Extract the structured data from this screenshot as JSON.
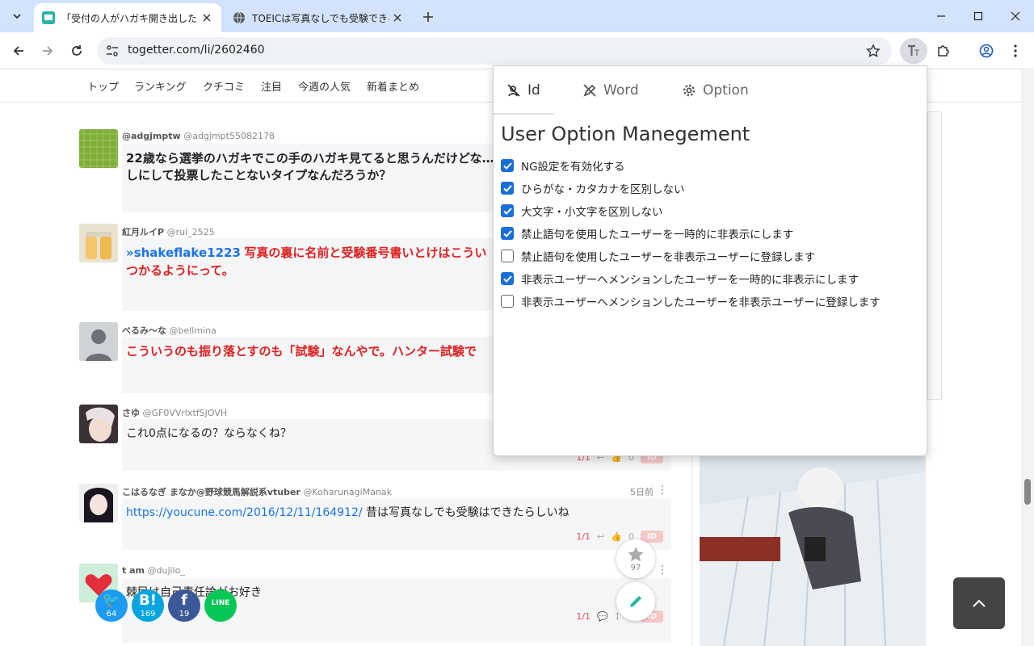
{
  "browser": {
    "tabs": [
      {
        "title": "「受付の人がハガキ開き出したとき？",
        "active": true
      },
      {
        "title": "TOEICは写真なしでも受験できる",
        "active": false
      }
    ],
    "url": "togetter.com/li/2602460"
  },
  "site_nav": [
    "トップ",
    "ランキング",
    "クチコミ",
    "注目",
    "今週の人気",
    "新着まとめ"
  ],
  "posts": [
    {
      "name": "@adgjmptw",
      "handle": "@adgjmpt55082178",
      "line1": "22歳なら選挙のハガキでこの手のハガキ見てると思うんだけどな… もし",
      "line2": "しにして投票したことないタイプなんだろうか？"
    },
    {
      "name": "紅月ルイP",
      "handle": "@rui_2525",
      "mention": "»shakeflake1223",
      "line1": "写真の裏に名前と受験番号書いとけはこうい",
      "line2": "つかるようにって。"
    },
    {
      "name": "べるみ～な",
      "handle": "@bellmina",
      "line1": "こういうのも振り落とすのも「試験」なんやで。ハンター試験で"
    },
    {
      "name": "さゆ",
      "handle": "@GF0VVrlxtfSJOVH",
      "line1": "これ0点になるの？ならなくね？",
      "page": "1/1",
      "likes": "0",
      "id": "ID"
    },
    {
      "name": "こはるなぎ まなか@野球競馬解説系vtuber",
      "handle": "@KoharunagiManak",
      "time": "5日前",
      "link": "https://youcune.com/2016/12/11/164912/",
      "line1": " 昔は写真なしでも受験はできたらしいね",
      "page": "1/1",
      "likes": "0",
      "id": "ID"
    },
    {
      "name": "t am",
      "handle": "@dujilo_",
      "line1": "棘民は自己責任論がお好き",
      "page": "1/1",
      "replies": "1",
      "id": "ID"
    }
  ],
  "share": [
    {
      "label": "twitter-share",
      "glyph": "🐦",
      "count": "64",
      "color": "#1d9bf0"
    },
    {
      "label": "hatena-share",
      "glyph": "B!",
      "count": "169",
      "color": "#00a4de"
    },
    {
      "label": "facebook-share",
      "glyph": "f",
      "count": "19",
      "color": "#3b5998"
    },
    {
      "label": "line-share",
      "glyph": "LINE",
      "count": "",
      "color": "#06c755"
    }
  ],
  "favorite_count": "97",
  "popup": {
    "tabs": [
      "Id",
      "Word",
      "Option"
    ],
    "title": "User Option Manegement",
    "options": [
      {
        "label": "NG設定を有効化する",
        "checked": true
      },
      {
        "label": "ひらがな・カタカナを区別しない",
        "checked": true
      },
      {
        "label": "大文字・小文字を区別しない",
        "checked": true
      },
      {
        "label": "禁止語句を使用したユーザーを一時的に非表示にします",
        "checked": true
      },
      {
        "label": "禁止語句を使用したユーザーを非表示ユーザーに登録します",
        "checked": false
      },
      {
        "label": "非表示ユーザーへメンションしたユーザーを一時的に非表示にします",
        "checked": true
      },
      {
        "label": "非表示ユーザーへメンションしたユーザーを非表示ユーザーに登録します",
        "checked": false
      }
    ]
  },
  "colors": {
    "accent": "#1a6ed8",
    "tabbar": "#d3e3fd",
    "red_text": "#e02020"
  }
}
